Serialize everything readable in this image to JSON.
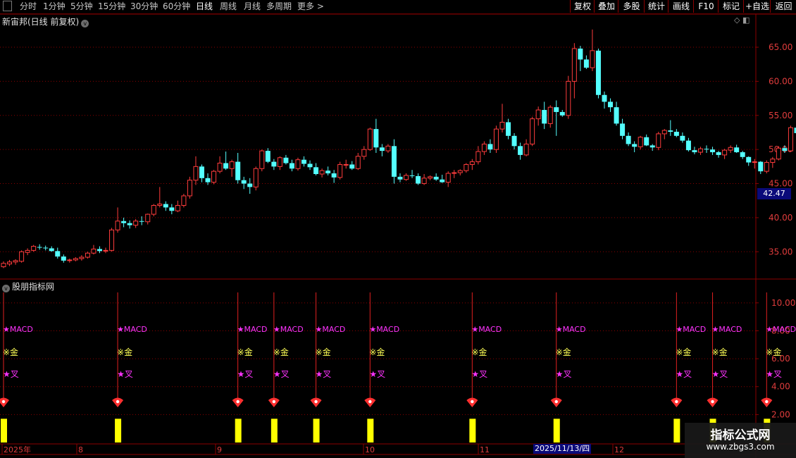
{
  "toolbar": {
    "periods": [
      {
        "label": "分时",
        "active": false
      },
      {
        "label": "1分钟",
        "active": false
      },
      {
        "label": "5分钟",
        "active": false
      },
      {
        "label": "15分钟",
        "active": false
      },
      {
        "label": "30分钟",
        "active": false
      },
      {
        "label": "60分钟",
        "active": false
      },
      {
        "label": "日线",
        "active": true
      },
      {
        "label": "周线",
        "active": false
      },
      {
        "label": "月线",
        "active": false
      },
      {
        "label": "多周期",
        "active": false
      },
      {
        "label": "更多 >",
        "active": false
      }
    ],
    "actions": [
      "复权",
      "叠加",
      "多股",
      "统计",
      "画线",
      "F10",
      "标记",
      "+自选",
      "返回"
    ]
  },
  "stock": {
    "title": "新宙邦(日线 前复权)"
  },
  "panel": {
    "title": "股朋指标网"
  },
  "price_axis": {
    "labels": [
      "65.00",
      "60.00",
      "55.00",
      "50.00",
      "45.00",
      "40.00",
      "35.00"
    ],
    "current": "42.47"
  },
  "indicator_axis": {
    "labels": [
      "10.00",
      "8.00",
      "6.00",
      "4.00",
      "2.00"
    ]
  },
  "signal": {
    "macd": "★MACD",
    "gold": "※金",
    "cross": "★叉"
  },
  "date_axis": {
    "labels": [
      "2025年",
      "8",
      "9",
      "10",
      "11",
      "12"
    ],
    "cursor": "2025/11/13/四"
  },
  "watermark": {
    "title": "指标公式网",
    "url": "www.zbgs3.com"
  },
  "colors": {
    "up": "#ff3c3c",
    "down": "#54ffff",
    "signal_line": "#e02020",
    "macd_text": "#ff33ff",
    "gold_text": "#ffff55",
    "cross_text": "#ff33ff",
    "bar": "#ffff00",
    "grid": "#8b0000"
  },
  "chart_data": {
    "type": "candlestick",
    "price_ylim": [
      31.0,
      68.0
    ],
    "indicator_ylim": [
      0.0,
      11.0
    ],
    "signal_bar_value": 1.7,
    "signal_days": [
      0,
      19,
      39,
      45,
      52,
      61,
      78,
      92,
      112,
      118,
      127
    ],
    "candles": [
      [
        32.8,
        33.6,
        32.6,
        33.3
      ],
      [
        33.2,
        33.8,
        32.9,
        33.5
      ],
      [
        33.5,
        33.9,
        33.1,
        33.7
      ],
      [
        33.6,
        35.2,
        33.4,
        35.0
      ],
      [
        34.9,
        35.5,
        34.5,
        35.2
      ],
      [
        35.2,
        36.0,
        35.0,
        35.8
      ],
      [
        35.7,
        36.1,
        35.3,
        35.6
      ],
      [
        35.6,
        35.9,
        35.2,
        35.5
      ],
      [
        35.5,
        35.8,
        35.0,
        35.1
      ],
      [
        35.1,
        35.6,
        34.0,
        34.3
      ],
      [
        34.3,
        34.6,
        33.4,
        33.7
      ],
      [
        33.7,
        34.0,
        33.4,
        33.8
      ],
      [
        33.8,
        34.2,
        33.6,
        34.0
      ],
      [
        34.0,
        34.5,
        33.7,
        34.2
      ],
      [
        34.2,
        35.0,
        34.0,
        34.8
      ],
      [
        34.8,
        36.0,
        34.6,
        35.4
      ],
      [
        35.4,
        35.8,
        34.8,
        35.1
      ],
      [
        35.1,
        35.6,
        34.8,
        35.2
      ],
      [
        35.2,
        38.5,
        35.0,
        38.2
      ],
      [
        38.2,
        41.5,
        37.8,
        39.5
      ],
      [
        39.5,
        40.0,
        38.6,
        39.2
      ],
      [
        39.2,
        39.6,
        38.4,
        38.9
      ],
      [
        38.9,
        39.8,
        38.5,
        39.5
      ],
      [
        39.5,
        40.2,
        38.9,
        39.4
      ],
      [
        39.4,
        40.6,
        39.0,
        40.5
      ],
      [
        40.5,
        42.0,
        40.2,
        41.8
      ],
      [
        41.8,
        44.5,
        41.5,
        42.0
      ],
      [
        42.0,
        42.4,
        41.0,
        41.5
      ],
      [
        41.5,
        42.0,
        40.5,
        41.0
      ],
      [
        41.0,
        42.5,
        40.8,
        41.8
      ],
      [
        41.8,
        43.5,
        41.5,
        43.2
      ],
      [
        43.2,
        46.0,
        42.8,
        45.5
      ],
      [
        45.5,
        49.0,
        44.8,
        47.5
      ],
      [
        47.5,
        47.8,
        45.2,
        45.8
      ],
      [
        45.8,
        46.5,
        44.8,
        45.2
      ],
      [
        45.2,
        47.0,
        44.9,
        46.8
      ],
      [
        46.8,
        49.0,
        46.5,
        48.0
      ],
      [
        48.0,
        49.7,
        47.0,
        47.2
      ],
      [
        47.2,
        48.5,
        46.0,
        48.2
      ],
      [
        48.2,
        49.5,
        45.0,
        45.5
      ],
      [
        45.5,
        46.0,
        44.2,
        45.0
      ],
      [
        45.0,
        45.8,
        43.5,
        44.5
      ],
      [
        44.5,
        47.5,
        44.0,
        47.2
      ],
      [
        47.2,
        50.0,
        46.8,
        49.8
      ],
      [
        49.8,
        50.2,
        48.0,
        48.2
      ],
      [
        48.2,
        48.6,
        47.0,
        47.5
      ],
      [
        47.5,
        49.0,
        47.0,
        48.8
      ],
      [
        48.8,
        49.2,
        47.8,
        48.0
      ],
      [
        48.0,
        48.5,
        46.8,
        47.2
      ],
      [
        47.2,
        48.8,
        46.9,
        48.5
      ],
      [
        48.5,
        49.0,
        47.5,
        47.9
      ],
      [
        47.9,
        48.4,
        47.0,
        47.4
      ],
      [
        47.4,
        48.0,
        46.2,
        46.4
      ],
      [
        46.4,
        47.2,
        45.9,
        46.9
      ],
      [
        46.9,
        47.5,
        46.2,
        46.5
      ],
      [
        46.5,
        47.0,
        45.1,
        45.9
      ],
      [
        45.9,
        48.2,
        45.6,
        47.8
      ],
      [
        47.8,
        48.5,
        47.2,
        47.8
      ],
      [
        47.8,
        48.3,
        47.0,
        47.2
      ],
      [
        47.2,
        49.5,
        47.0,
        49.0
      ],
      [
        49.0,
        50.5,
        48.5,
        50.0
      ],
      [
        50.0,
        53.2,
        49.8,
        53.0
      ],
      [
        53.0,
        54.5,
        49.5,
        50.3
      ],
      [
        50.3,
        50.8,
        49.0,
        49.8
      ],
      [
        49.8,
        50.8,
        49.5,
        50.5
      ],
      [
        50.5,
        51.5,
        45.0,
        46.0
      ],
      [
        46.0,
        46.5,
        45.2,
        45.6
      ],
      [
        45.6,
        46.5,
        45.4,
        46.2
      ],
      [
        46.2,
        47.0,
        45.8,
        46.1
      ],
      [
        46.1,
        46.5,
        44.8,
        45.0
      ],
      [
        45.0,
        46.4,
        44.8,
        45.8
      ],
      [
        45.8,
        46.2,
        45.5,
        46.0
      ],
      [
        46.0,
        46.5,
        45.4,
        45.6
      ],
      [
        45.6,
        46.3,
        45.1,
        45.2
      ],
      [
        45.2,
        46.8,
        44.5,
        46.5
      ],
      [
        46.5,
        47.0,
        45.8,
        46.6
      ],
      [
        46.6,
        47.1,
        46.2,
        46.9
      ],
      [
        46.9,
        48.0,
        46.6,
        47.8
      ],
      [
        47.8,
        48.6,
        47.0,
        48.2
      ],
      [
        48.2,
        50.5,
        47.8,
        49.7
      ],
      [
        49.7,
        51.2,
        49.2,
        50.8
      ],
      [
        50.8,
        51.5,
        49.5,
        50.0
      ],
      [
        50.0,
        53.5,
        49.5,
        53.0
      ],
      [
        53.0,
        56.7,
        52.5,
        54.0
      ],
      [
        54.0,
        54.5,
        51.5,
        52.0
      ],
      [
        52.0,
        52.4,
        50.0,
        50.5
      ],
      [
        50.5,
        51.0,
        48.5,
        49.2
      ],
      [
        49.2,
        51.5,
        49.0,
        50.8
      ],
      [
        50.8,
        54.8,
        50.5,
        54.5
      ],
      [
        54.5,
        56.3,
        53.5,
        55.8
      ],
      [
        55.8,
        57.0,
        53.0,
        53.8
      ],
      [
        53.8,
        56.5,
        53.2,
        56.2
      ],
      [
        56.2,
        57.2,
        52.0,
        55.5
      ],
      [
        55.5,
        55.8,
        54.8,
        55.0
      ],
      [
        55.0,
        60.8,
        54.5,
        60.0
      ],
      [
        60.0,
        65.6,
        57.5,
        64.8
      ],
      [
        64.8,
        65.2,
        61.5,
        63.2
      ],
      [
        63.2,
        63.8,
        61.8,
        62.0
      ],
      [
        62.0,
        67.6,
        61.5,
        64.5
      ],
      [
        64.5,
        64.8,
        57.5,
        58.0
      ],
      [
        58.0,
        58.5,
        56.0,
        57.0
      ],
      [
        57.0,
        57.5,
        55.5,
        56.2
      ],
      [
        56.2,
        57.0,
        53.5,
        53.8
      ],
      [
        53.8,
        54.5,
        51.5,
        52.0
      ],
      [
        52.0,
        52.5,
        50.5,
        50.8
      ],
      [
        50.8,
        51.2,
        49.6,
        50.4
      ],
      [
        50.4,
        52.0,
        50.0,
        51.8
      ],
      [
        51.8,
        52.2,
        50.5,
        50.6
      ],
      [
        50.6,
        50.8,
        49.8,
        50.3
      ],
      [
        50.3,
        52.6,
        49.9,
        52.3
      ],
      [
        52.3,
        53.0,
        51.5,
        52.8
      ],
      [
        52.8,
        54.3,
        52.0,
        52.6
      ],
      [
        52.6,
        53.0,
        51.8,
        52.0
      ],
      [
        52.0,
        52.5,
        51.0,
        51.3
      ],
      [
        51.3,
        51.7,
        49.7,
        49.9
      ],
      [
        49.9,
        50.4,
        49.3,
        49.6
      ],
      [
        49.6,
        50.4,
        49.2,
        50.1
      ],
      [
        50.1,
        50.6,
        49.5,
        50.0
      ],
      [
        50.0,
        50.4,
        49.2,
        49.6
      ],
      [
        49.6,
        49.8,
        48.8,
        49.2
      ],
      [
        49.2,
        50.1,
        48.6,
        49.9
      ],
      [
        49.9,
        50.6,
        49.5,
        50.3
      ],
      [
        50.3,
        50.7,
        49.5,
        49.6
      ],
      [
        49.6,
        49.8,
        48.6,
        48.9
      ],
      [
        48.9,
        49.0,
        47.6,
        48.1
      ],
      [
        48.1,
        48.6,
        47.2,
        48.2
      ],
      [
        48.2,
        48.3,
        46.4,
        46.8
      ],
      [
        46.8,
        48.4,
        46.5,
        48.1
      ],
      [
        48.1,
        48.9,
        47.3,
        48.6
      ],
      [
        48.6,
        50.5,
        48.4,
        50.2
      ],
      [
        50.2,
        50.6,
        49.5,
        49.8
      ],
      [
        49.8,
        53.5,
        49.7,
        53.2
      ],
      [
        53.2,
        53.9,
        52.0,
        52.4
      ],
      [
        52.4,
        54.3,
        52.2,
        53.4
      ],
      [
        53.4,
        53.4,
        52.9,
        53.0
      ]
    ]
  }
}
